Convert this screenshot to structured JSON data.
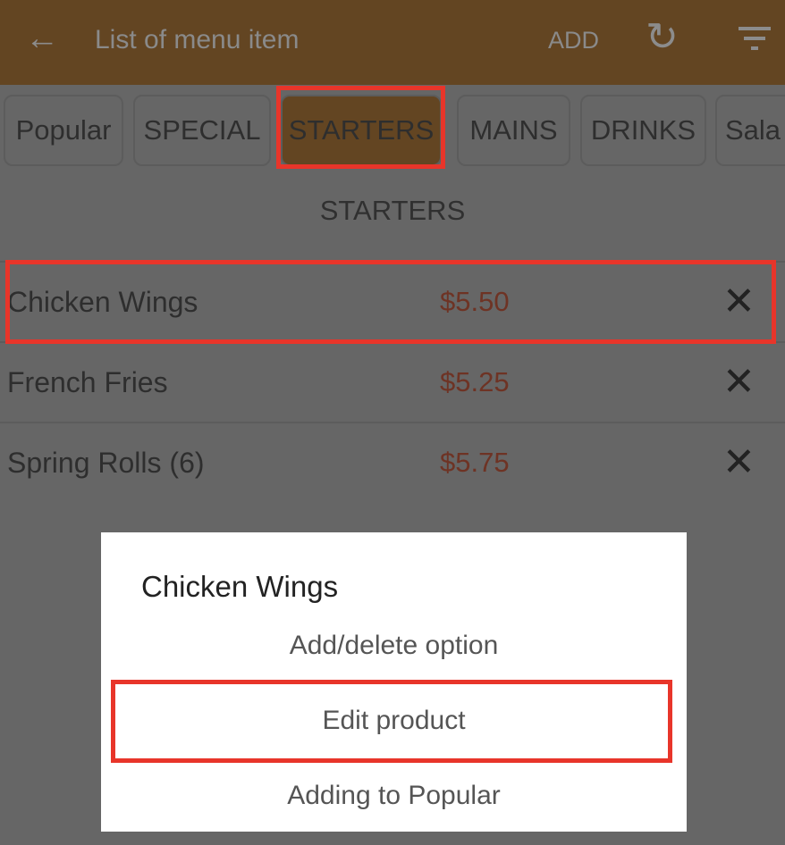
{
  "header": {
    "back_icon": "arrow-left-icon",
    "title": "List of menu item",
    "add_label": "ADD",
    "refresh_icon": "refresh-icon",
    "filter_icon": "filter-icon",
    "color": "#634522"
  },
  "tabs": [
    {
      "label": "Popular"
    },
    {
      "label": "SPECIAL"
    },
    {
      "label": "STARTERS",
      "active": true
    },
    {
      "label": "MAINS"
    },
    {
      "label": "DRINKS"
    },
    {
      "label": "Sala"
    }
  ],
  "section_title": "STARTERS",
  "items": [
    {
      "name": "Chicken Wings",
      "price": "$5.50"
    },
    {
      "name": "French Fries",
      "price": "$5.25"
    },
    {
      "name": "Spring Rolls (6)",
      "price": "$5.75"
    }
  ],
  "dialog": {
    "title": "Chicken Wings",
    "options": [
      "Add/delete option",
      "Edit product",
      "Adding to Popular"
    ]
  },
  "highlight_color": "#e8352a"
}
